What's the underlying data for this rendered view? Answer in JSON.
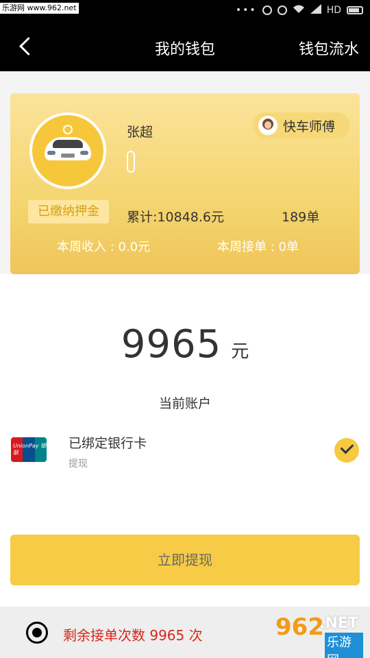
{
  "status_bar": {
    "watermark": "乐游网 www.962.net",
    "network": "HD"
  },
  "nav": {
    "title": "我的钱包",
    "right_link": "钱包流水"
  },
  "profile": {
    "name": "张超",
    "role": "快车师傅",
    "deposit_badge": "已缴纳押金",
    "total": "累计:10848.6元",
    "orders": "189单",
    "week_income": "本周收入 : 0.0元",
    "week_orders": "本周接单 : 0单"
  },
  "balance": {
    "amount": "9965",
    "unit": "元",
    "account_label": "当前账户"
  },
  "bank": {
    "title": "已绑定银行卡",
    "subtitle": "提现",
    "logo_text": "UnionPay 银联"
  },
  "actions": {
    "withdraw": "立即提现"
  },
  "footer": {
    "remaining": "剩余接单次数 9965 次",
    "watermark_num": "962",
    "watermark_site": ".NET",
    "watermark_cn": "乐游网"
  },
  "colors": {
    "accent": "#f7cb45",
    "card_gradient_top": "#fbe39b",
    "warning_text": "#d8261b"
  }
}
